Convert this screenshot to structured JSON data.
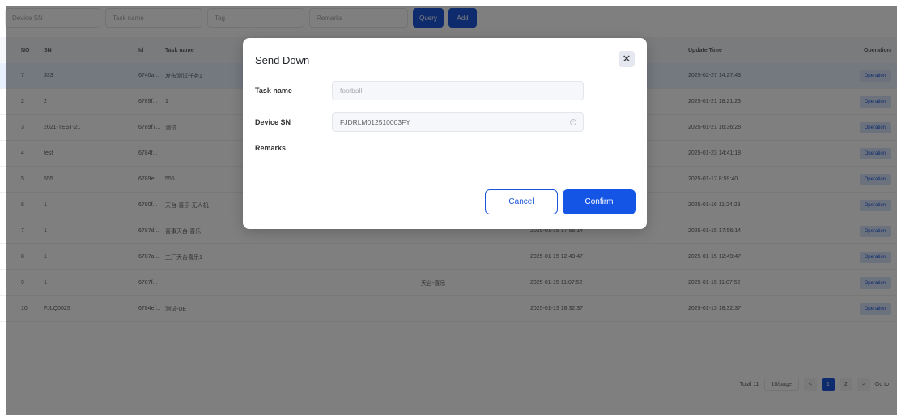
{
  "toolbar": {
    "device_sn_placeholder": "Device SN",
    "task_name_placeholder": "Task name",
    "tag_placeholder": "Tag",
    "remarks_placeholder": "Remarks",
    "query_label": "Query",
    "add_label": "Add"
  },
  "table": {
    "headers": [
      "NO",
      "SN",
      "Id",
      "Task name",
      "",
      "",
      "Update Time",
      "Operation"
    ],
    "rows": [
      {
        "no": "7",
        "sn": "333",
        "id": "6740a...",
        "name": "发布测试任务1",
        "tag": "",
        "create": "",
        "update": "2025-02-27 14:27:43",
        "op": "Operation"
      },
      {
        "no": "2",
        "sn": "2",
        "id": "6789f...",
        "name": "1",
        "tag": "",
        "create": "",
        "update": "2025-01-21 18:21:23",
        "op": "Operation"
      },
      {
        "no": "3",
        "sn": "2021-TEST-21",
        "id": "6789f7...",
        "name": "测试",
        "tag": "",
        "create": "",
        "update": "2025-01-21 16:36:28",
        "op": "Operation"
      },
      {
        "no": "4",
        "sn": "test",
        "id": "6784f...",
        "name": "",
        "tag": "",
        "create": "",
        "update": "2025-01-23 14:41:18",
        "op": "Operation"
      },
      {
        "no": "5",
        "sn": "555",
        "id": "6789e...",
        "name": "555",
        "tag": "",
        "create": "",
        "update": "2025-01-17 8:59:40",
        "op": "Operation"
      },
      {
        "no": "6",
        "sn": "1",
        "id": "6780f...",
        "name": "天台-喜乐-无人机",
        "tag": "",
        "create": "",
        "update": "2025-01-16 11:24:28",
        "op": "Operation"
      },
      {
        "no": "7",
        "sn": "1",
        "id": "6787d...",
        "name": "喜事天台-喜乐",
        "tag": "",
        "create": "2025-01-15 17:56:14",
        "update": "2025-01-15 17:56:14",
        "op": "Operation"
      },
      {
        "no": "8",
        "sn": "1",
        "id": "6787a...",
        "name": "工厂天台喜乐1",
        "tag": "",
        "create": "2025-01-15 12:49:47",
        "update": "2025-01-15 12:49:47",
        "op": "Operation"
      },
      {
        "no": "9",
        "sn": "1",
        "id": "6787f...",
        "name": "",
        "tag": "天台-喜乐",
        "create": "2025-01-15 11:07:52",
        "update": "2025-01-15 11:07:52",
        "op": "Operation"
      },
      {
        "no": "10",
        "sn": "FJLQ0025",
        "id": "6784ef...",
        "name": "测试-UE",
        "tag": "",
        "create": "2025-01-13 18:32:37",
        "update": "2025-01-13 18:32:37",
        "op": "Operation"
      }
    ]
  },
  "pagination": {
    "total": "Total 11",
    "page_size": "10/page",
    "prev": "<",
    "pages": [
      "1",
      "2"
    ],
    "next": ">",
    "goto": "Go to"
  },
  "dialog": {
    "title": "Send Down",
    "close": "✕",
    "task_name_label": "Task name",
    "task_name_value": "football",
    "device_sn_label": "Device SN",
    "device_sn_value": "FJDRLM012510003FY",
    "remarks_label": "Remarks",
    "cancel_label": "Cancel",
    "confirm_label": "Confirm"
  },
  "colors": {
    "primary": "#1455e6",
    "overlay": "rgba(0,0,0,0.5)"
  }
}
